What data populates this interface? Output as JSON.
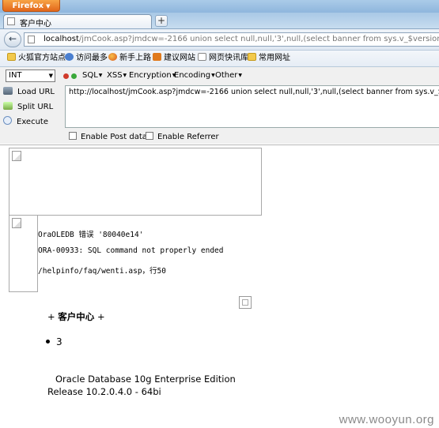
{
  "browser": {
    "app_button": "Firefox",
    "tab_title": "客户中心",
    "new_tab_symbol": "+",
    "back_symbol": "←",
    "url_host": "localhost",
    "url_rest": "/jmCook.asp?jmdcw=-2166 union select null,null,'3',null,(select banner from sys.v_$version where rownum="
  },
  "bookmarks": [
    {
      "label": "火狐官方站点",
      "icon": "folder-icon"
    },
    {
      "label": "访问最多",
      "icon": "globe-icon"
    },
    {
      "label": "新手上路",
      "icon": "firefox-icon"
    },
    {
      "label": "建议网站",
      "icon": "suggest-icon"
    },
    {
      "label": "网页快讯库",
      "icon": "page-icon"
    },
    {
      "label": "常用网址",
      "icon": "folder-icon"
    }
  ],
  "hackbar": {
    "select_value": "INT",
    "menus": [
      "SQL",
      "XSS",
      "Encryption",
      "Encoding",
      "Other"
    ],
    "load_url": "Load URL",
    "split_url": "Split URL",
    "execute": "Execute",
    "url_value": "http://localhost/jmCook.asp?jmdcw=-2166 union select null,null,'3',null,(select banner from sys.v_$version where",
    "enable_post": "Enable Post data",
    "enable_referrer": "Enable Referrer"
  },
  "page": {
    "error_lines": [
      "OraOLEDB 错误 '80040e14'",
      "ORA-00933: SQL command not properly ended",
      "/helpinfo/faq/wenti.asp，行50"
    ],
    "customer_prefix": "+",
    "customer_center": "客户中心",
    "customer_suffix": "+",
    "list_item": "3",
    "version_line1": "Oracle Database 10g Enterprise Edition",
    "version_line2": "Release 10.2.0.4.0 - 64bi"
  },
  "watermark": "www.wooyun.org"
}
